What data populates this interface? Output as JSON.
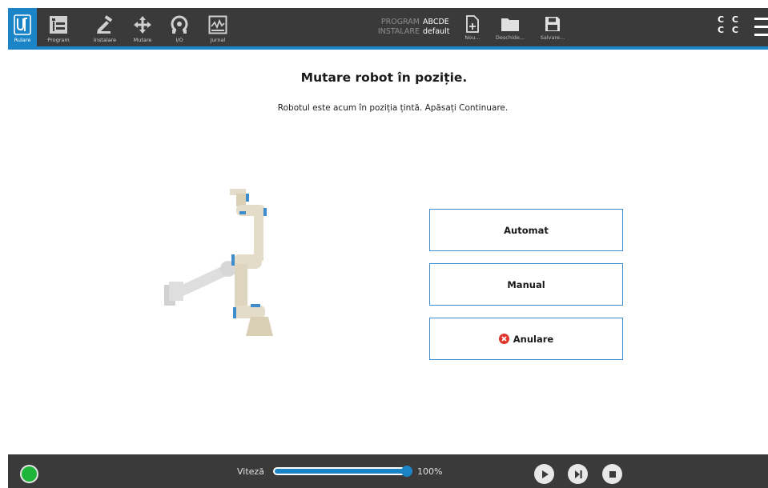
{
  "header": {
    "nav": [
      {
        "label": "Rulare",
        "icon": "ur-logo-icon",
        "active": true
      },
      {
        "label": "Program",
        "icon": "program-icon"
      },
      {
        "label": "Instalare",
        "icon": "installation-icon"
      },
      {
        "label": "Mutare",
        "icon": "move-arrows-icon"
      },
      {
        "label": "I/O",
        "icon": "io-icon"
      },
      {
        "label": "Jurnal",
        "icon": "log-icon"
      }
    ],
    "program_key": "PROGRAM",
    "program_value": "ABCDE",
    "installation_key": "INSTALARE",
    "installation_value": "default",
    "file_buttons": [
      {
        "label": "Nou...",
        "icon": "new-file-icon"
      },
      {
        "label": "Deschide...",
        "icon": "folder-icon"
      },
      {
        "label": "Salvare...",
        "icon": "save-icon"
      }
    ],
    "cc_top": "C C",
    "cc_bottom": "C C"
  },
  "main": {
    "title": "Mutare robot în poziție.",
    "subtitle": "Robotul este acum în poziția țintă. Apăsați Continuare.",
    "buttons": {
      "auto": "Automat",
      "manual": "Manual",
      "cancel": "Anulare"
    }
  },
  "footer": {
    "speed_label": "Viteză",
    "speed_value": "100%",
    "speed_fraction": 1.0
  },
  "colors": {
    "accent": "#1a84c7",
    "bar": "#3a3a3a",
    "status_ok": "#1fb53a",
    "cancel_red": "#e0342b"
  }
}
